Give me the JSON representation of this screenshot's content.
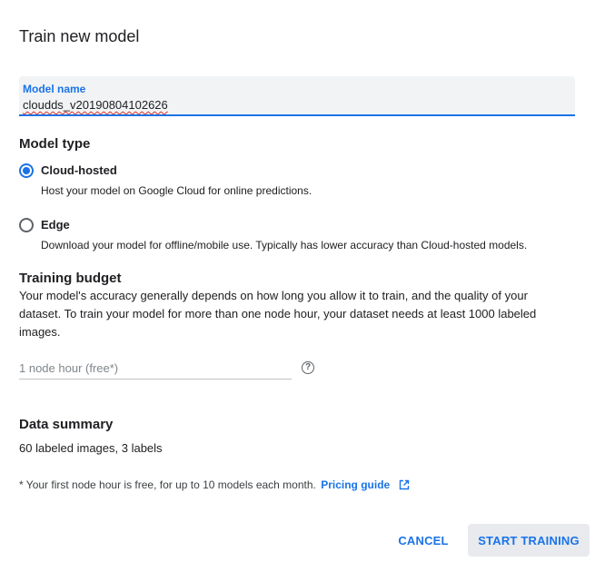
{
  "dialog": {
    "title": "Train new model"
  },
  "model_name": {
    "label": "Model name",
    "value": "cloudds_v20190804102626"
  },
  "model_type": {
    "heading": "Model type",
    "options": [
      {
        "label": "Cloud-hosted",
        "description": "Host your model on Google Cloud for online predictions.",
        "selected": true
      },
      {
        "label": "Edge",
        "description": "Download your model for offline/mobile use. Typically has lower accuracy than Cloud-hosted models.",
        "selected": false
      }
    ]
  },
  "training_budget": {
    "heading": "Training budget",
    "line1": "Your model's accuracy generally depends on how long you allow it to train, and the quality of your",
    "line2": "dataset. To train your model for more than one node hour, your dataset needs at least 1000 labeled",
    "line3": "images.",
    "input_placeholder": "1 node hour (free*)",
    "help_icon": "help-circle-icon"
  },
  "data_summary": {
    "heading": "Data summary",
    "text": "60 labeled images, 3 labels"
  },
  "footnote": {
    "text": "* Your first node hour is free, for up to 10 models each month.",
    "link_label": "Pricing guide",
    "link_icon": "open-in-new-icon"
  },
  "actions": {
    "cancel_label": "CANCEL",
    "start_label": "START TRAINING"
  },
  "colors": {
    "accent": "#1a73e8",
    "text": "#202124",
    "field_bg": "#f1f3f4",
    "button_bg": "#e8eaed"
  }
}
